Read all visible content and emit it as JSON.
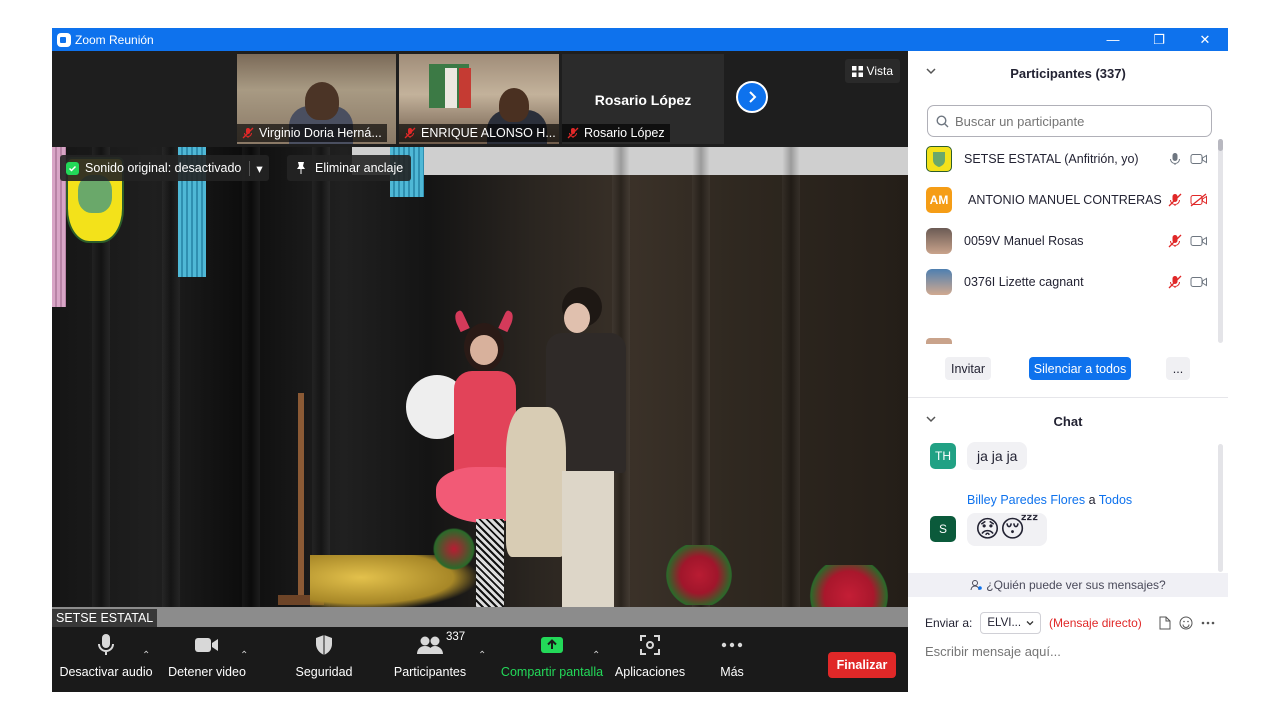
{
  "window": {
    "title": "Zoom Reunión"
  },
  "strip": {
    "thumbs": [
      {
        "name": "Virginio Doria Herná..."
      },
      {
        "name": "ENRIQUE ALONSO H..."
      },
      {
        "name": "Rosario López",
        "display_name": "Rosario López"
      }
    ],
    "view_label": "Vista"
  },
  "stage": {
    "original_sound": "Sonido original: desactivado",
    "unpin": "Eliminar anclaje",
    "self_name": "SETSE ESTATAL"
  },
  "toolbar": {
    "mute": "Desactivar audio",
    "video": "Detener video",
    "security": "Seguridad",
    "participants": "Participantes",
    "participants_count": "337",
    "share": "Compartir pantalla",
    "apps": "Aplicaciones",
    "more": "Más",
    "end": "Finalizar"
  },
  "participants_panel": {
    "title": "Participantes (337)",
    "search_placeholder": "Buscar un participante",
    "rows": [
      {
        "name": "SETSE ESTATAL (Anfitrión, yo)"
      },
      {
        "initials": "AM",
        "name": "ANTONIO MANUEL CONTRERAS"
      },
      {
        "name": "0059V Manuel Rosas"
      },
      {
        "name": "0376I Lizette cagnant"
      }
    ],
    "invite": "Invitar",
    "mute_all": "Silenciar a todos",
    "more": "..."
  },
  "chat": {
    "title": "Chat",
    "messages": [
      {
        "initials": "TH",
        "text": "ja ja ja"
      },
      {
        "initials": "S",
        "sender": "Billey Paredes Flores",
        "to": "a",
        "target": "Todos",
        "text": "😟😴"
      }
    ],
    "who_sees": "¿Quién puede ver sus mensajes?",
    "send_to_label": "Enviar a:",
    "recipient": "ELVI...",
    "direct_msg": "(Mensaje directo)",
    "input_placeholder": "Escribir mensaje aquí..."
  },
  "colors": {
    "zoom_blue": "#0e72ed",
    "end_red": "#e02828",
    "share_green": "#23d959",
    "amber_avatar": "#f59d16",
    "teal_avatar": "#21a184",
    "dark_green_avatar": "#0b5a3b"
  }
}
